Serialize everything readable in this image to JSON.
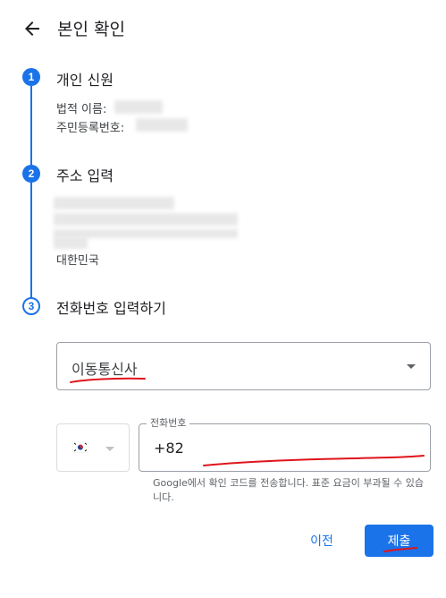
{
  "header": {
    "title": "본인 확인",
    "back_icon": "arrow-back-icon"
  },
  "steps": [
    {
      "number": "1",
      "title": "개인 신원",
      "fields": [
        {
          "label": "법적 이름:"
        },
        {
          "label": "주민등록번호:"
        }
      ]
    },
    {
      "number": "2",
      "title": "주소 입력",
      "country": "대한민국"
    },
    {
      "number": "3",
      "title": "전화번호 입력하기"
    }
  ],
  "carrier_select": {
    "value": "이동통신사",
    "icon": "arrow-drop-down-icon"
  },
  "country_picker": {
    "flag_icon": "korea-flag-icon",
    "caret_icon": "arrow-drop-down-icon"
  },
  "phone_field": {
    "label": "전화번호",
    "value": "+82"
  },
  "helper_text": "Google에서 확인 코드를 전송합니다. 표준 요금이 부과될 수 있습니다.",
  "actions": {
    "prev_label": "이전",
    "submit_label": "제출"
  },
  "colors": {
    "accent": "#1a73e8",
    "annotation": "#e0141c"
  }
}
